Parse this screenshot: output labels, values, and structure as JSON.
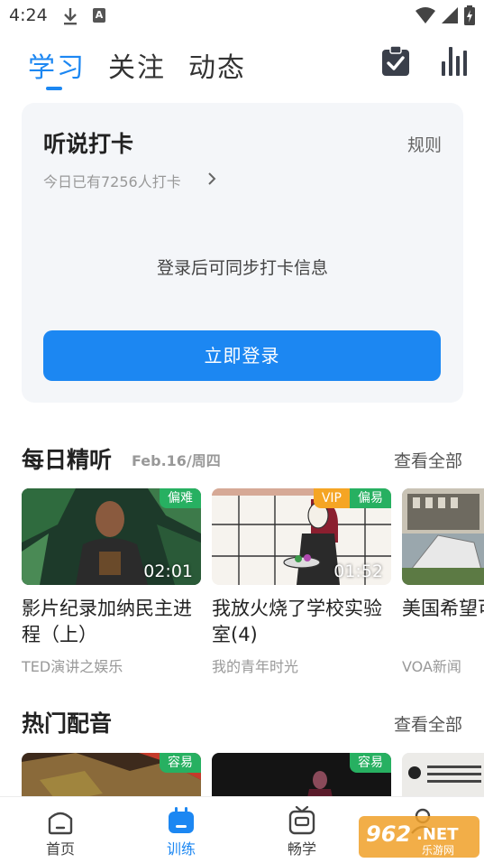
{
  "status_bar": {
    "time": "4:24"
  },
  "top_tabs": [
    {
      "label": "学习",
      "active": true
    },
    {
      "label": "关注",
      "active": false
    },
    {
      "label": "动态",
      "active": false
    }
  ],
  "checkin": {
    "title": "听说打卡",
    "rule": "规则",
    "subtitle": "今日已有7256人打卡",
    "message": "登录后可同步打卡信息",
    "login_button": "立即登录"
  },
  "daily": {
    "title": "每日精听",
    "date": "Feb.16/周四",
    "more": "查看全部",
    "items": [
      {
        "title": "影片纪录加纳民主进程（上）",
        "source": "TED演讲之娱乐",
        "duration": "02:01",
        "badges": [
          "偏难"
        ]
      },
      {
        "title": "我放火烧了学校实验室(4)",
        "source": "我的青年时光",
        "duration": "01:52",
        "badges": [
          "VIP",
          "偏易"
        ]
      },
      {
        "title": "美国希望可归者",
        "source": "VOA新闻",
        "duration": "",
        "badges": []
      }
    ]
  },
  "dubbing": {
    "title": "热门配音",
    "more": "查看全部",
    "items": [
      {
        "badge": "容易"
      },
      {
        "badge": "容易"
      },
      {
        "badge": ""
      }
    ]
  },
  "bottom_nav": [
    {
      "label": "首页",
      "icon": "home-icon",
      "active": false
    },
    {
      "label": "训练",
      "icon": "training-icon",
      "active": true
    },
    {
      "label": "畅学",
      "icon": "tv-icon",
      "active": false
    },
    {
      "label": "",
      "icon": "profile-icon",
      "active": false
    }
  ],
  "watermark": {
    "text": "962.NET",
    "sub": "乐游网"
  },
  "colors": {
    "accent": "#1c87f2",
    "badge_green": "#27b061",
    "badge_orange": "#f5a524"
  }
}
